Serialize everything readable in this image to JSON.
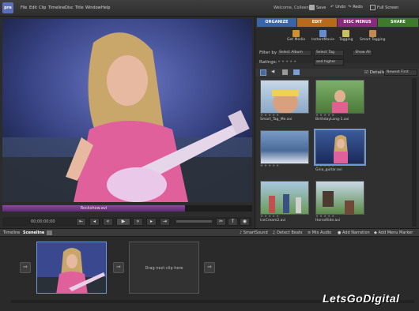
{
  "app": {
    "logo": "pre"
  },
  "menu": [
    "File",
    "Edit",
    "Clip",
    "Timeline",
    "Disc",
    "Title",
    "Window",
    "Help"
  ],
  "header": {
    "welcome": "Welcome, Colleen",
    "save": "Save",
    "undo": "Undo",
    "redo": "Redo",
    "fullscreen": "Full Screen"
  },
  "monitor": {
    "clip_name": "Rockshow.avi",
    "timecode": "00;00;00;00",
    "progress": 0.73
  },
  "tabs": [
    "ORGANIZE",
    "EDIT",
    "DISC MENUS",
    "SHARE"
  ],
  "tools": [
    "Get Media",
    "InstantMovie",
    "Tagging",
    "Smart Tagging"
  ],
  "filter": {
    "label": "Filter by:",
    "album": "Select Album",
    "tag": "Select Tag",
    "show_all": "Show All"
  },
  "ratings": {
    "label": "Ratings:",
    "qualifier": "and higher"
  },
  "view": {
    "details": "Details",
    "sort": "Newest First"
  },
  "media": [
    {
      "name": "Smart_Tag_Me.avi"
    },
    {
      "name": "BirthdayLong-1.avi"
    },
    {
      "name": ""
    },
    {
      "name": "Gina_guitar.avi"
    },
    {
      "name": "IceCream2.avi"
    },
    {
      "name": "HorseRide.avi"
    }
  ],
  "timeline": {
    "tab_timeline": "Timeline",
    "tab_sceneline": "Sceneline",
    "smartsound": "SmartSound",
    "detect_beats": "Detect Beats",
    "mix_audio": "Mix Audio",
    "add_narration": "Add Narration",
    "add_menu_marker": "Add Menu Marker"
  },
  "sceneline": {
    "placeholder": "Drag next clip here"
  },
  "watermark": "LetsGoDigital",
  "colors": {
    "organize": "#3a64a8",
    "edit": "#b56a1c",
    "disc": "#8a2a7a",
    "share": "#3f7a2c",
    "accent": "#6d9ad6"
  }
}
